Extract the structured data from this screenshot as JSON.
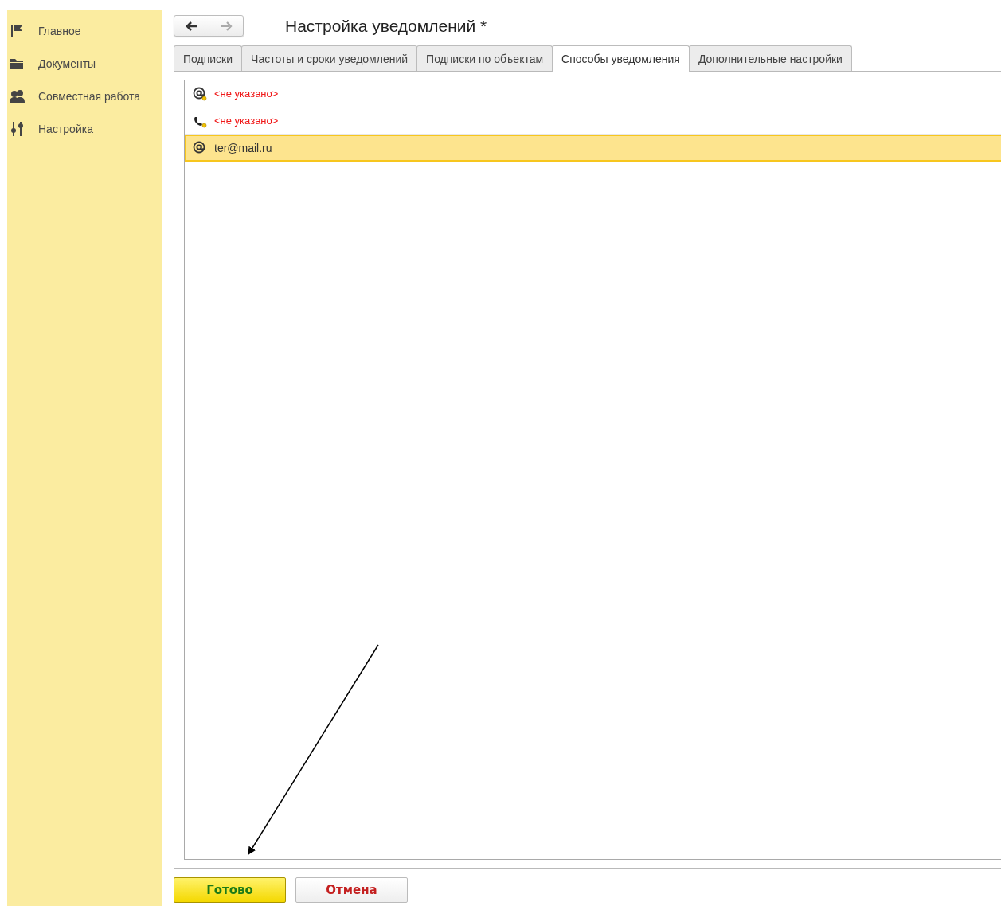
{
  "sidebar": {
    "items": [
      {
        "kind": "flag",
        "label": "Главное"
      },
      {
        "kind": "folder",
        "label": "Документы"
      },
      {
        "kind": "people",
        "label": "Совместная работа"
      },
      {
        "kind": "sliders",
        "label": "Настройка"
      }
    ]
  },
  "form": {
    "title": "Настройка уведомлений *",
    "tabs": [
      {
        "label": "Подписки",
        "selected": false
      },
      {
        "label": "Частоты и сроки уведомлений",
        "selected": false
      },
      {
        "label": "Подписки по объектам",
        "selected": false
      },
      {
        "label": "Способы уведомления",
        "selected": true
      },
      {
        "label": "Дополнительные настройки",
        "selected": false
      }
    ],
    "rows": [
      {
        "kind": "email",
        "text": "<не указано>",
        "unset": true,
        "selected": false
      },
      {
        "kind": "phone",
        "text": "<не указано>",
        "unset": true,
        "selected": false
      },
      {
        "kind": "email",
        "text": "ter@mail.ru",
        "unset": false,
        "selected": true
      }
    ],
    "buttons": [
      {
        "kind": "primary",
        "label": "Готово"
      },
      {
        "kind": "cancel",
        "label": "Отмена"
      }
    ]
  }
}
